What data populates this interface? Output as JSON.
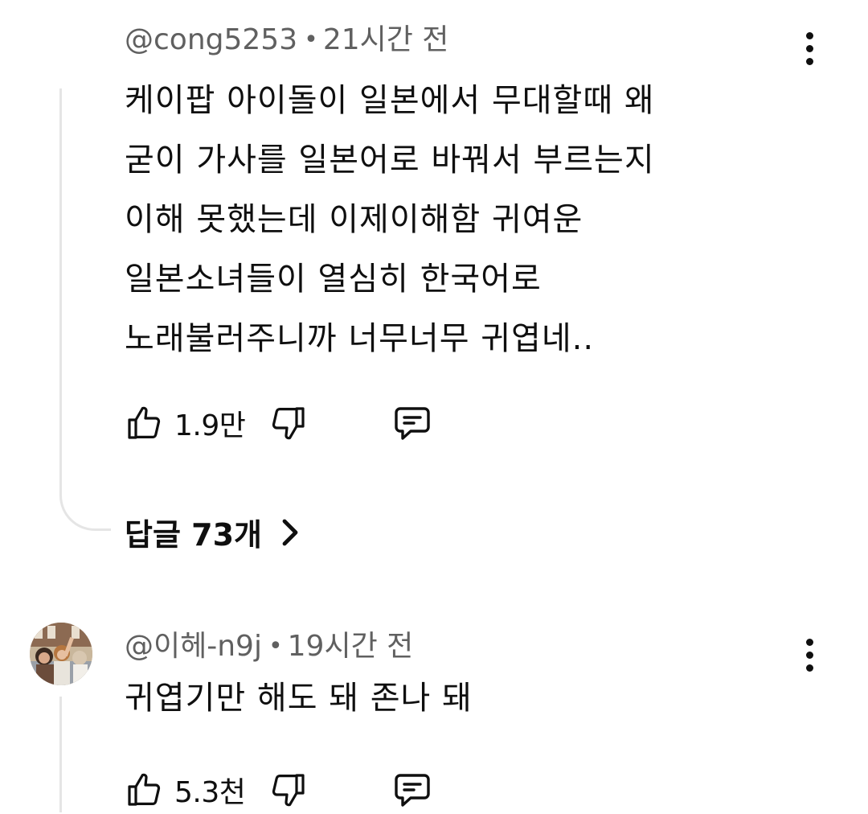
{
  "comments": [
    {
      "author": "@cong5253",
      "separator": "•",
      "time": "21시간 전",
      "lines": [
        "케이팝 아이돌이 일본에서 무대할때 왜",
        "굳이 가사를 일본어로 바꿔서 부르는지",
        "이해 못했는데 이제이해함 귀여운",
        "일본소녀들이 열심히 한국어로",
        "노래불러주니까 너무너무 귀엽네.."
      ],
      "like_count": "1.9만",
      "replies_label": "답글 73개"
    },
    {
      "author": "@이헤-n9j",
      "separator": "•",
      "time": "19시간 전",
      "lines": [
        "귀엽기만 해도 돼 존나 돼"
      ],
      "like_count": "5.3천"
    }
  ],
  "icons": {
    "like": "thumbs-up-icon",
    "dislike": "thumbs-down-icon",
    "reply": "comment-bubble-icon",
    "more": "more-vert-icon",
    "replies_expand": "chevron-right-icon"
  },
  "colors": {
    "text_primary": "#0f0f0f",
    "text_secondary": "#606060",
    "thread_line": "#e5e5e5",
    "background": "#ffffff"
  }
}
